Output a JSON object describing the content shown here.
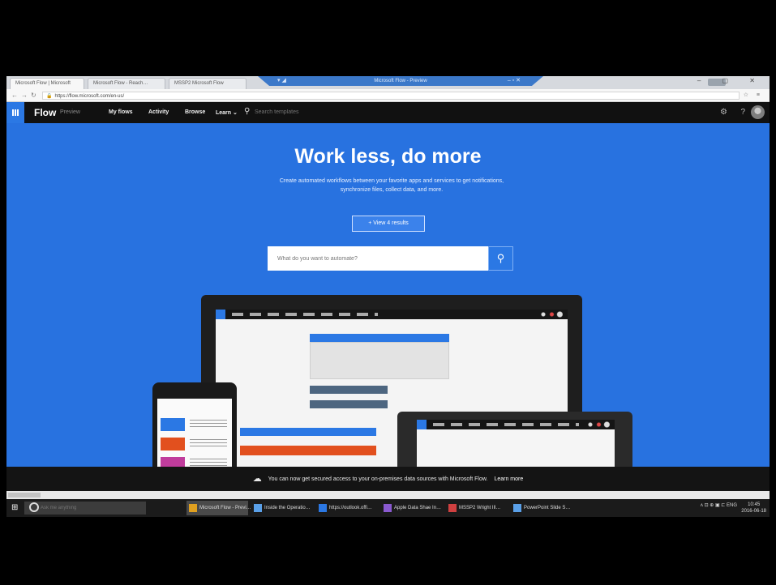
{
  "browser": {
    "tabs": [
      {
        "label": "Microsoft Flow | Microsoft"
      },
      {
        "label": "Microsoft Flow - Reach…"
      },
      {
        "label": "MSSP2 Microsoft Flow"
      }
    ],
    "remote_title": "Microsoft Flow - Preview",
    "url": "https://flow.microsoft.com/en-us/",
    "lock_symbol": "🔒",
    "window_controls": "– ▢ ✕"
  },
  "flow_nav": {
    "brand": "Flow",
    "badge": "Preview",
    "links": [
      "My flows",
      "Activity",
      "Browse",
      "Learn ⌄"
    ],
    "search_placeholder": "Search templates",
    "search_icon": "⚲",
    "settings_icon": "⚙",
    "help_icon": "?"
  },
  "hero": {
    "title": "Work less, do more",
    "subtitle": "Create automated workflows between your favorite apps and services to get notifications, synchronize files, collect data, and more.",
    "view_button": "+ View 4 results",
    "search_placeholder": "What do you want to automate?",
    "search_icon": "⚲"
  },
  "notice": {
    "icon": "☁",
    "text": "You can now get secured access to your on-premises data sources with Microsoft Flow.",
    "link": "Learn more"
  },
  "taskbar": {
    "start_icon": "⊞",
    "cortana_placeholder": "Ask me anything",
    "items": [
      {
        "label": "Microsoft Flow - Previ…",
        "color": "#e0a020"
      },
      {
        "label": "Inside the Operatio…",
        "color": "#5aa0e8"
      },
      {
        "label": "https://outlook.offi…",
        "color": "#2b78e4"
      },
      {
        "label": "Apple Data Shae In…",
        "color": "#8a5ad0"
      },
      {
        "label": "MSSP2 Wright Ill…",
        "color": "#d04040"
      },
      {
        "label": "PowerPoint Slide S…",
        "color": "#5aa0e8"
      }
    ],
    "tray": "ʌ ⊡ ⊕ ▣ ⊏ ENG",
    "clock_time": "10:45",
    "clock_date": "2016-06-18"
  },
  "colors": {
    "accent": "#2872e0",
    "nav_bg": "#111111",
    "notice_bg": "#141414"
  }
}
